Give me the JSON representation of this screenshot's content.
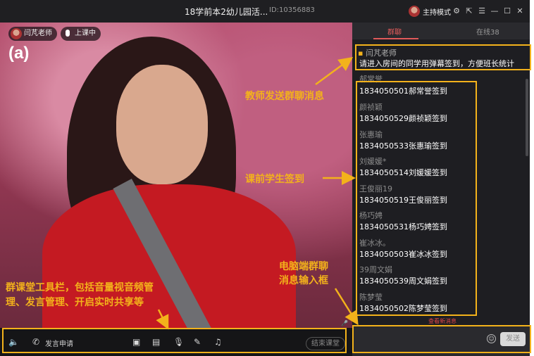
{
  "window": {
    "title": "18学前本2幼儿园活...",
    "room_id": "ID:10356883",
    "host_mode": "主持模式"
  },
  "video": {
    "teacher_name": "闫芃老师",
    "class_status": "上课中",
    "panel_tag": "(a)"
  },
  "toolbar": {
    "speak_request": "发言申请",
    "end_class": "结束课堂"
  },
  "chat": {
    "tab_group": "群聊",
    "tab_online": "在线38",
    "teacher_message": {
      "name": "闫芃老师",
      "text": "请进入房间的同学用弹幕签到，方便班长统计"
    },
    "partial_name": "郝常誉",
    "messages": [
      {
        "name": "",
        "text": "1834050501郝常誉签到"
      },
      {
        "name": "颜祯颖",
        "text": "1834050529颜祯颖签到"
      },
      {
        "name": "张惠瑜",
        "text": "1834050533张惠瑜签到"
      },
      {
        "name": "刘媛媛*",
        "text": "1834050514刘媛媛签到"
      },
      {
        "name": "王俊丽19",
        "text": "1834050519王俊丽签到"
      },
      {
        "name": "杨巧娉",
        "text": "1834050531杨巧娉签到"
      },
      {
        "name": "崔冰冰。",
        "text": "1834050503崔冰冰签到"
      },
      {
        "name": "39周文娟",
        "text": "1834050539周文娟签到"
      },
      {
        "name": "陈梦莹",
        "text": "1834050502陈梦莹签到"
      }
    ],
    "see_new": "查看新消息",
    "send": "发送"
  },
  "annotations": {
    "teacher_send": "教师发送群聊消息",
    "student_signin": "课前学生签到",
    "input_line1": "电脑端群聊",
    "input_line2": "消息输入框",
    "toolbar_line1": "群课堂工具栏，包括音量视音频管",
    "toolbar_line2": "理、发言管理、开启实时共享等"
  },
  "colors": {
    "annotation": "#f3b21b",
    "accent": "#e05a5a"
  }
}
